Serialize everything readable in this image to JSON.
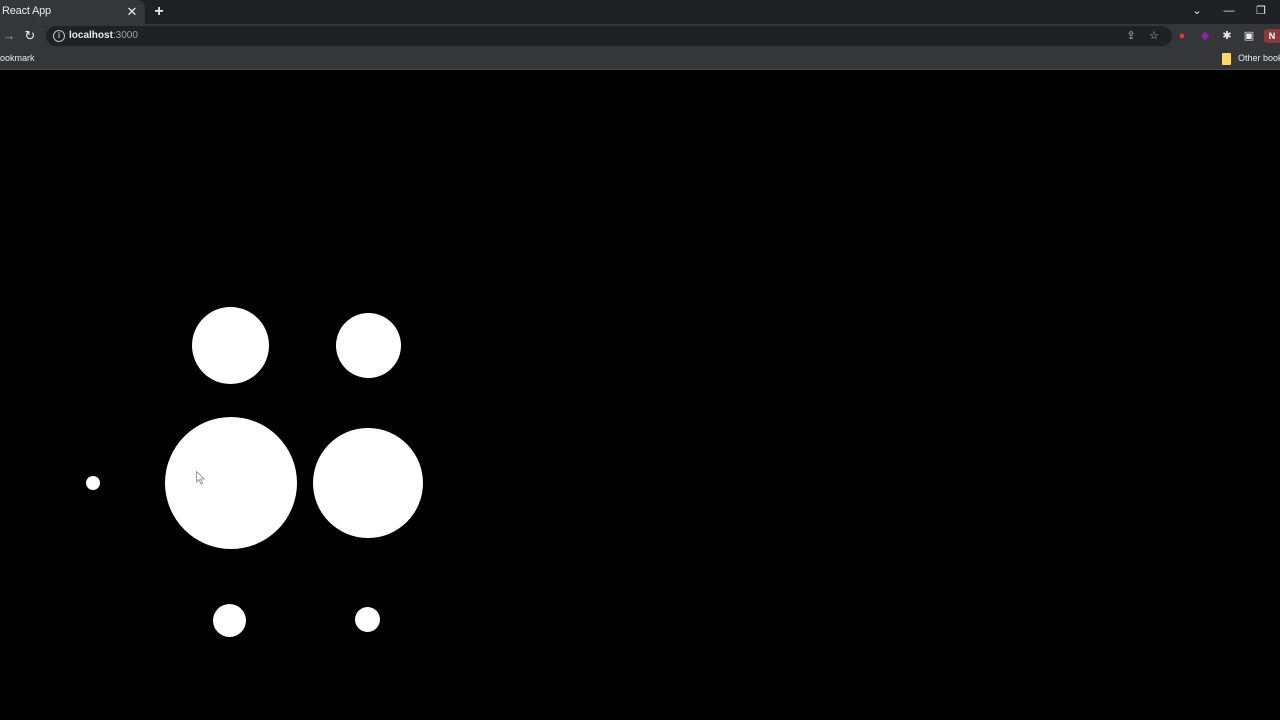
{
  "browser": {
    "tab_title": "React App",
    "tab_close_icon": "close-icon",
    "new_tab_icon": "plus-icon",
    "url_host": "localhost",
    "url_port": ":3000",
    "bookmark_label": "ookmark",
    "other_bookmarks_label": "Other book",
    "profile_initial": "N",
    "colors": {
      "tabstrip": "#202124",
      "toolbar": "#35363a",
      "omnibox": "#202124",
      "folder": "#fdd663",
      "profile": "#8b3a3a"
    }
  },
  "page": {
    "background": "#000000",
    "circle_color": "#ffffff",
    "circle_count": 7
  }
}
